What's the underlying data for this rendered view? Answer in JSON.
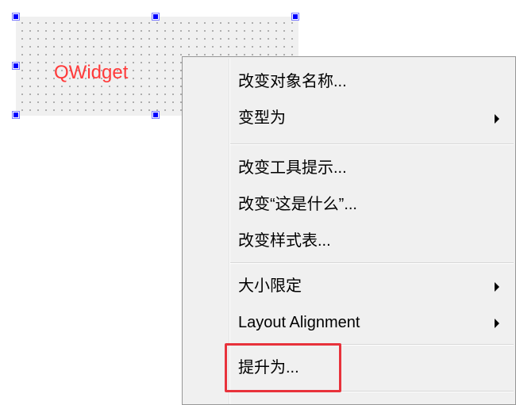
{
  "form": {
    "widget_label": "QWidget"
  },
  "context_menu": {
    "items": [
      {
        "label": "改变对象名称..."
      },
      {
        "label": "变型为",
        "has_submenu": true
      },
      {
        "label": "改变工具提示..."
      },
      {
        "label": "改变“这是什么”..."
      },
      {
        "label": "改变样式表..."
      },
      {
        "label": "大小限定",
        "has_submenu": true
      },
      {
        "label": "Layout Alignment",
        "has_submenu": true
      },
      {
        "label": "提升为..."
      }
    ]
  },
  "annotation": {
    "highlight_color": "#e8323b",
    "highlighted_item": "提升为..."
  }
}
